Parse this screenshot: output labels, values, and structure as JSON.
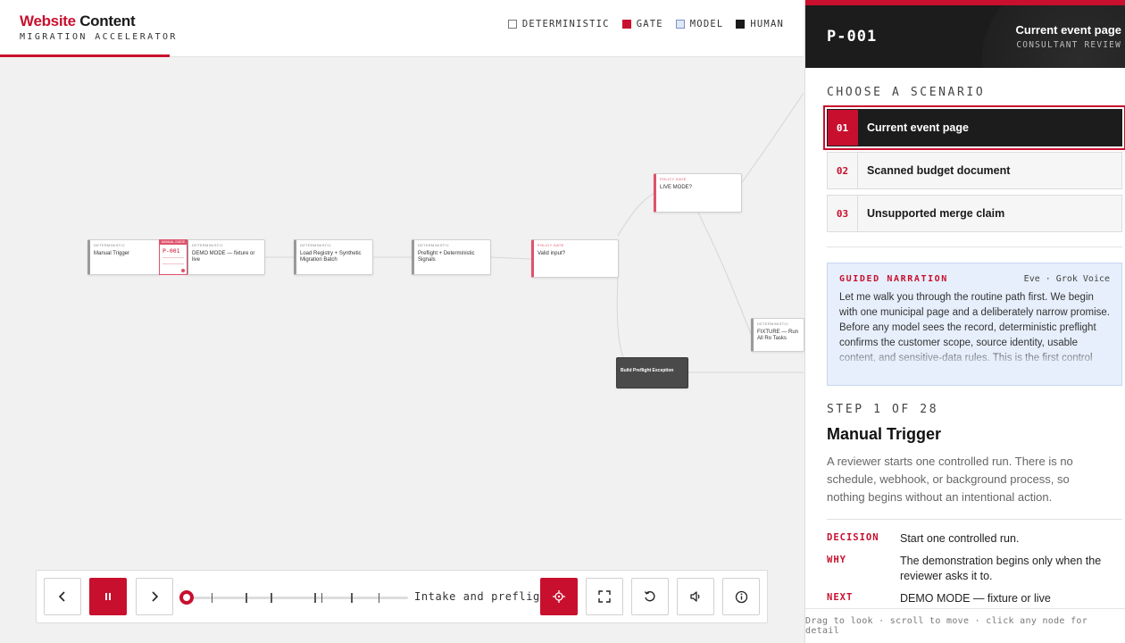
{
  "brand": {
    "title_accent": "Website",
    "title_rest": " Content",
    "subtitle": "MIGRATION ACCELERATOR"
  },
  "legend": [
    {
      "label": "DETERMINISTIC",
      "color": "#ffffff",
      "border": "#777777"
    },
    {
      "label": "GATE",
      "color": "#c8102e",
      "border": "#c8102e"
    },
    {
      "label": "MODEL",
      "color": "#dfe8f6",
      "border": "#7b93c2"
    },
    {
      "label": "HUMAN",
      "color": "#1a1a1a",
      "border": "#1a1a1a"
    }
  ],
  "workflow": {
    "nodes": [
      {
        "category": "DETERMINISTIC",
        "label": "Manual Trigger"
      },
      {
        "category": "DETERMINISTIC",
        "label": "DEMO MODE — fixture or live"
      },
      {
        "category": "DETERMINISTIC",
        "label": "Load Registry + Synthetic Migration Batch"
      },
      {
        "category": "DETERMINISTIC",
        "label": "Preflight + Deterministic Signals"
      },
      {
        "category": "POLICY GATE",
        "label": "Valid input?"
      },
      {
        "category": "POLICY GATE",
        "label": "LIVE MODE?"
      },
      {
        "category": "DETERMINISTIC",
        "label": "FIXTURE — Run All Ro Tasks"
      },
      {
        "category": "",
        "label": "Build Preflight Exception"
      }
    ],
    "token": {
      "header": "MANUAL GUIDE",
      "id": "P-001"
    }
  },
  "playback": {
    "phase": "Intake and preflight",
    "progress": 0.0,
    "ticks": [
      0.14,
      0.29,
      0.4,
      0.59,
      0.62,
      0.75,
      0.87
    ]
  },
  "panel": {
    "id": "P-001",
    "title": "Current event page",
    "subtitle": "CONSULTANT REVIEW",
    "scenario_heading": "CHOOSE A SCENARIO",
    "scenarios": [
      {
        "num": "01",
        "name": "Current event page",
        "active": true
      },
      {
        "num": "02",
        "name": "Scanned budget document",
        "active": false
      },
      {
        "num": "03",
        "name": "Unsupported merge claim",
        "active": false
      }
    ],
    "narration": {
      "title": "GUIDED NARRATION",
      "voice": "Eve · Grok Voice",
      "text": "Let me walk you through the routine path first. We begin with one municipal page and a deliberately narrow promise. Before any model sees the record, deterministic preflight confirms the customer scope, source identity, usable content, and sensitive-data rules. This is the first control point: if the answer is no, the record never reaches a model."
    },
    "step": {
      "counter": "STEP 1 OF 28",
      "title": "Manual Trigger",
      "description": "A reviewer starts one controlled run. There is no schedule, webhook, or background process, so nothing begins without an intentional action."
    },
    "facts": [
      {
        "key": "DECISION",
        "value": "Start one controlled run."
      },
      {
        "key": "WHY",
        "value": "The demonstration begins only when the reviewer asks it to."
      },
      {
        "key": "NEXT",
        "value": "DEMO MODE — fixture or live"
      }
    ],
    "footer": "Drag to look · scroll to move · click any node for detail"
  }
}
